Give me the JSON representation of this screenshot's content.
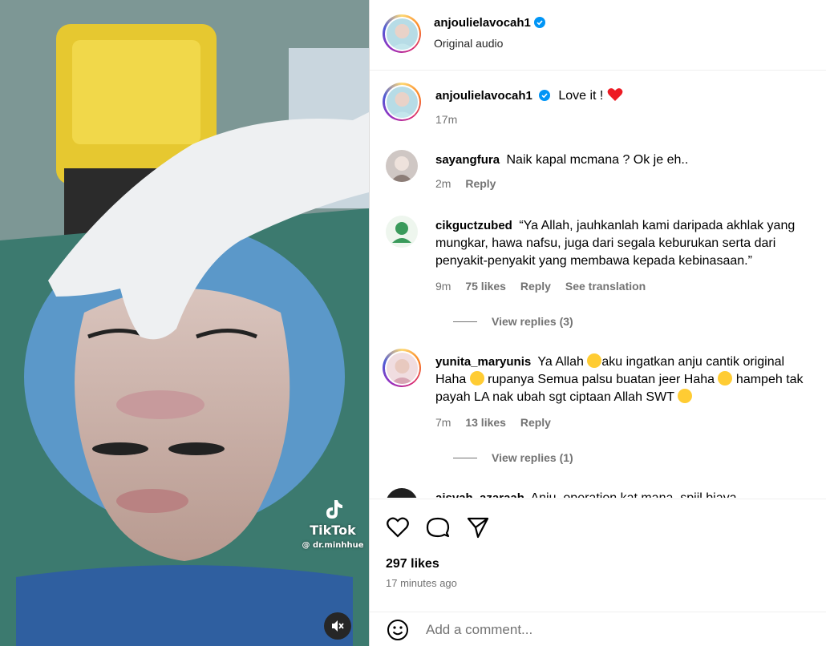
{
  "media": {
    "watermark_brand": "TikTok",
    "watermark_handle": "@ dr.minhhue",
    "mute_icon": "speaker-muted-icon"
  },
  "header": {
    "username": "anjoulielavocah1",
    "verified": true,
    "subtitle": "Original audio"
  },
  "comments": [
    {
      "username": "anjoulielavocah1",
      "verified": true,
      "text": "Love it !",
      "emoji": "red-heart",
      "time": "17m"
    },
    {
      "username": "sayangfura",
      "text": "Naik kapal mcmana ? Ok je eh..",
      "time": "2m",
      "reply_label": "Reply"
    },
    {
      "username": "cikguctzubed",
      "text": "“Ya Allah, jauhkanlah kami daripada akhlak yang mungkar, hawa nafsu, juga dari segala keburukan serta dari penyakit-penyakit yang membawa kepada kebinasaan.”",
      "time": "9m",
      "likes": "75 likes",
      "reply_label": "Reply",
      "translate_label": "See translation",
      "view_replies": "View replies (3)"
    },
    {
      "username": "yunita_maryunis",
      "text_parts": [
        "Ya Allah",
        "aku ingatkan anju cantik original Haha",
        "rupanya Semua palsu buatan jeer Haha",
        "hampeh tak payah LA nak ubah sgt ciptaan Allah SWT"
      ],
      "time": "7m",
      "likes": "13 likes",
      "reply_label": "Reply",
      "view_replies": "View replies (1)"
    },
    {
      "username": "aisyah_azaraah",
      "text": "Anju, operation kat mana, spjjl biaya"
    }
  ],
  "actions": {
    "likes": "297 likes",
    "time_ago": "17 minutes ago",
    "comment_placeholder": "Add a comment..."
  },
  "colors": {
    "verified": "#0095f6",
    "heart": "#ed1b24",
    "muted_text": "#737373",
    "divider": "#dbdbdb"
  }
}
